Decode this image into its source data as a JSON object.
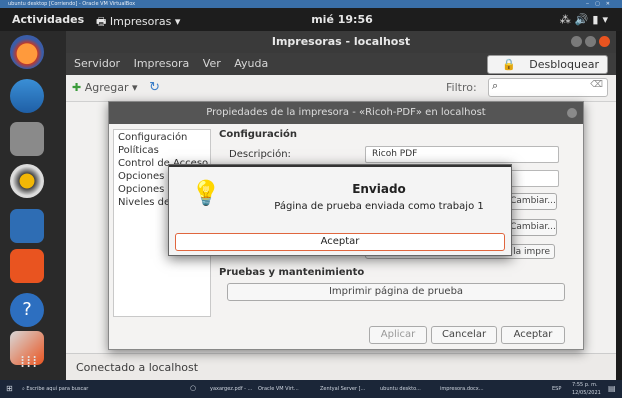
{
  "vbox_bar": {
    "title": "ubuntu desktop [Corriendo] - Oracle VM VirtualBox"
  },
  "top_panel": {
    "activities": "Actividades",
    "app_menu": "Impresoras",
    "clock": "mié 19:56"
  },
  "main_window": {
    "title": "Impresoras - localhost",
    "menu": [
      "Servidor",
      "Impresora",
      "Ver",
      "Ayuda"
    ],
    "unlock_button": "Desbloquear",
    "toolbar": {
      "add_label": "Agregar",
      "filter_label": "Filtro:"
    },
    "status": "Conectado a localhost"
  },
  "properties_dialog": {
    "title": "Propiedades de la impresora - «Ricoh-PDF» en localhost",
    "nav_items": [
      "Configuración",
      "Políticas",
      "Control de Acceso",
      "Opciones de",
      "Opciones d",
      "Niveles de t"
    ],
    "section_settings": "Configuración",
    "description_label": "Descripción:",
    "description_value": "Ricoh PDF",
    "change_button_1": "Cambiar...",
    "change_button_2": "Cambiar...",
    "state_partial": "la impre",
    "section_tests": "Pruebas y mantenimiento",
    "print_test_button": "Imprimir página de prueba",
    "apply_button": "Aplicar",
    "cancel_button": "Cancelar",
    "accept_button": "Aceptar"
  },
  "sent_dialog": {
    "title": "Enviado",
    "message": "Página de prueba enviada como trabajo 1",
    "ok_button": "Aceptar"
  },
  "taskbar": {
    "search": "Escribe aquí para buscar",
    "apps": [
      "yaxargez.pdf - ...",
      "Oracle VM Virt...",
      "Zentyal Server [...",
      "ubuntu deskto...",
      "impresora.docx..."
    ],
    "tray_text": "ESP",
    "time": "7:55 p. m.",
    "date": "12/05/2021"
  },
  "colors": {
    "accent": "#e95420",
    "panel": "#1d1d1d",
    "dock": "#2a2a2a",
    "taskbar": "#1b2638"
  }
}
